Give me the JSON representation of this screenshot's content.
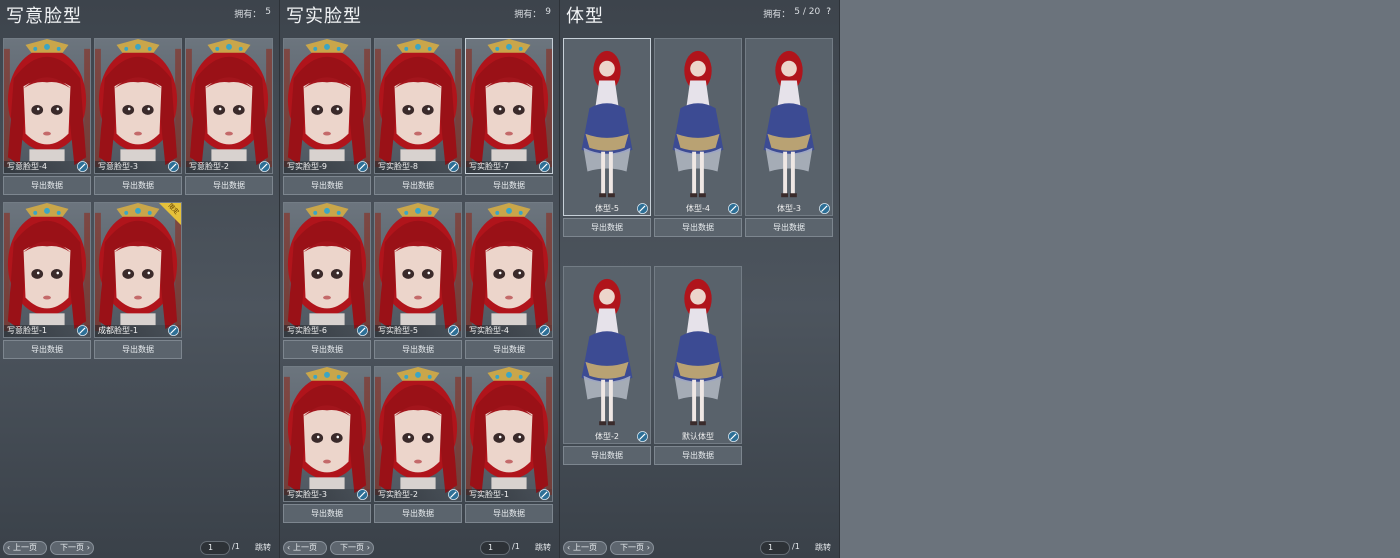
{
  "panels": {
    "stylized": {
      "title": "写意脸型",
      "owned_label": "拥有：",
      "owned_value": "5",
      "cards": [
        {
          "label": "写意脸型-4"
        },
        {
          "label": "写意脸型-3"
        },
        {
          "label": "写意脸型-2"
        },
        {
          "label": "写意脸型-1"
        },
        {
          "label": "成都脸型-1",
          "badge": "限定"
        }
      ],
      "export_label": "导出数据"
    },
    "realistic": {
      "title": "写实脸型",
      "owned_label": "拥有：",
      "owned_value": "9",
      "cards": [
        {
          "label": "写实脸型-9"
        },
        {
          "label": "写实脸型-8"
        },
        {
          "label": "写实脸型-7"
        },
        {
          "label": "写实脸型-6"
        },
        {
          "label": "写实脸型-5"
        },
        {
          "label": "写实脸型-4"
        },
        {
          "label": "写实脸型-3"
        },
        {
          "label": "写实脸型-2"
        },
        {
          "label": "写实脸型-1"
        }
      ],
      "export_label": "导出数据"
    },
    "body": {
      "title": "体型",
      "owned_label": "拥有：",
      "owned_value": "5 / 20",
      "help": "?",
      "cards": [
        {
          "label": "体型-5"
        },
        {
          "label": "体型-4"
        },
        {
          "label": "体型-3"
        },
        {
          "label": "体型-2"
        },
        {
          "label": "默认体型"
        }
      ],
      "export_label": "导出数据"
    }
  },
  "pager": {
    "prev": "上一页",
    "next": "下一页",
    "page": "1",
    "total": "/1",
    "jump": "跳转"
  },
  "colors": {
    "hair": "#b0141b",
    "skin": "#ecd5cb",
    "accent_blue": "#2d6f96",
    "badge_gold": "#e5c13a"
  },
  "icons": {
    "edit": "brush-icon",
    "help": "help-icon"
  }
}
